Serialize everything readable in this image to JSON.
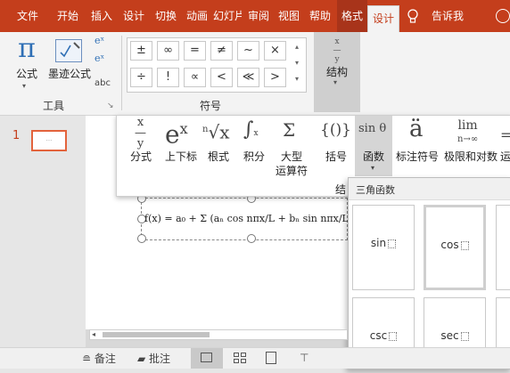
{
  "tabs": [
    "文件",
    "开始",
    "插入",
    "设计",
    "切换",
    "动画",
    "幻灯片",
    "审阅",
    "视图",
    "帮助",
    "格式",
    "设计"
  ],
  "tell_me": "告诉我",
  "tools_group": {
    "equation": "公式",
    "ink_equation": "墨迹公式",
    "abc": "abc",
    "label": "工具"
  },
  "symbols": {
    "row1": [
      "±",
      "∞",
      "=",
      "≠",
      "~",
      "×"
    ],
    "row2": [
      "÷",
      "!",
      "∝",
      "<",
      "≪",
      ">"
    ],
    "label": "符号"
  },
  "structure_btn": "结构",
  "structures": [
    {
      "label": "分式",
      "glyph": "x/y"
    },
    {
      "label": "上下标",
      "glyph": "eˣ"
    },
    {
      "label": "根式",
      "glyph": "ⁿ√x"
    },
    {
      "label": "积分",
      "glyph": "∫"
    },
    {
      "label": "大型\n运算符",
      "glyph": "Σ"
    },
    {
      "label": "括号",
      "glyph": "{()}"
    },
    {
      "label": "函数",
      "glyph": "sin θ"
    },
    {
      "label": "标注符号",
      "glyph": "ä"
    },
    {
      "label": "极限和对数",
      "glyph": "lim"
    },
    {
      "label": "运",
      "glyph": "="
    }
  ],
  "structures_group_partial": "结",
  "slide_number": "1",
  "equation_text": "f(x) = a₀ + Σ (aₙ cos nπx/L + bₙ sin nπx/L)",
  "dropdown": {
    "header": "三角函数",
    "items": [
      "sin",
      "cos",
      "csc",
      "sec"
    ]
  },
  "status": {
    "notes": "备注",
    "comments": "批注"
  },
  "colors": {
    "accent": "#c43e1c",
    "context_tab": "#a8341a",
    "slide_marker": "#e3633c"
  }
}
